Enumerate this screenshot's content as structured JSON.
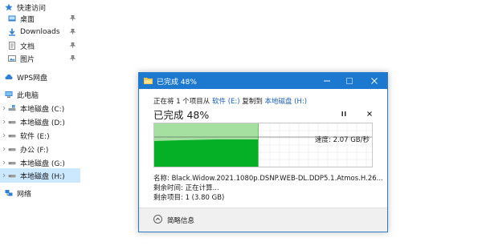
{
  "nav": {
    "quick_access": "快速访问",
    "desktop": "桌面",
    "downloads": "Downloads",
    "documents": "文档",
    "pictures": "图片",
    "wps": "WPS网盘",
    "this_pc": "此电脑",
    "drive_c": "本地磁盘 (C:)",
    "drive_d": "本地磁盘 (D:)",
    "drive_e": "软件 (E:)",
    "drive_f": "办公 (F:)",
    "drive_g": "本地磁盘 (G:)",
    "drive_h": "本地磁盘 (H:)",
    "network": "网络"
  },
  "dialog": {
    "title": "已完成 48%",
    "copy_prefix": "正在将 1 个项目从",
    "copy_source": "软件 (E:)",
    "copy_middle": "复制到",
    "copy_dest": "本地磁盘 (H:)",
    "headline": "已完成 48%",
    "progress_percent": 48,
    "speed": "速度: 2.07 GB/秒",
    "name_row": "名称:  Black.Widow.2021.1080p.DSNP.WEB-DL.DDP5.1.Atmos.H.26...",
    "time_row": "剩余时间:  正在计算...",
    "items_row": "剩余项目:  1 (3.80 GB)",
    "less_details": "简略信息",
    "colors": {
      "titlebar": "#1c79cf",
      "graph_light": "#a5e0a1",
      "graph_dark": "#06b026"
    }
  }
}
